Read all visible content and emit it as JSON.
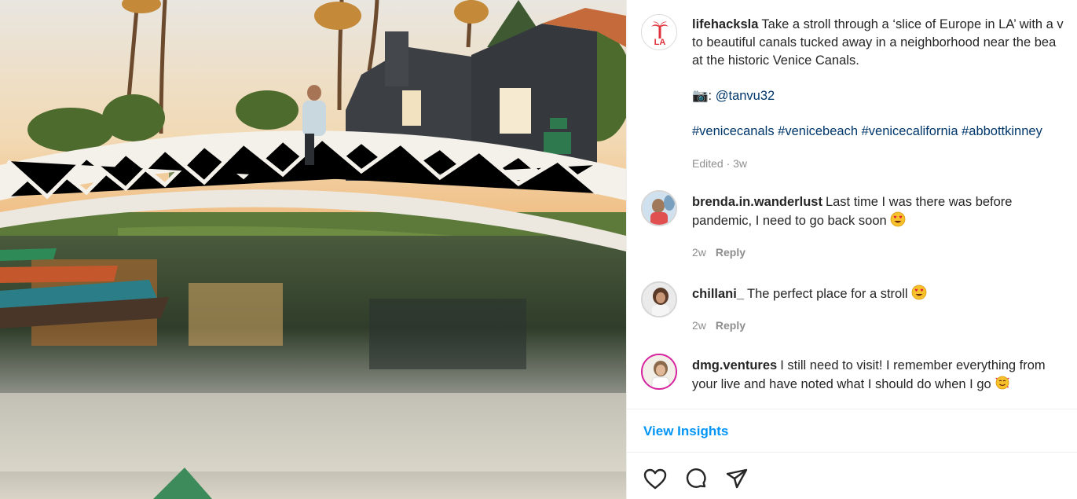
{
  "post": {
    "author": "lifehacksla",
    "caption_line1": "Take a stroll through a ‘slice of Europe in LA’ with a v",
    "caption_line2": "to beautiful canals tucked away in a neighborhood near the bea",
    "caption_line3": "at the historic Venice Canals.",
    "camera_emoji": "📷",
    "photo_credit_sep": ":",
    "photo_credit": "@tanvu32",
    "hashtags": [
      "#venicecanals",
      "#venicebeach",
      "#venicecalifornia",
      "#abbottkinney"
    ],
    "edited": "Edited · 3w"
  },
  "comments": [
    {
      "user": "brenda.in.wanderlust",
      "line1": "Last time I was there was before",
      "line2": "pandemic, I need to go back soon",
      "emoji": "heart-eyes",
      "age": "2w",
      "reply": "Reply"
    },
    {
      "user": "chillani_",
      "line1": "The perfect place for a stroll",
      "emoji": "heart-eyes",
      "age": "2w",
      "reply": "Reply"
    },
    {
      "user": "dmg.ventures",
      "line1": "I still need to visit! I remember everything from",
      "line2": "your live and have noted what I should do when I go",
      "emoji": "smiling-hearts"
    }
  ],
  "insights_label": "View Insights",
  "actions": {
    "like": "heart-icon",
    "comment": "comment-icon",
    "share": "share-icon"
  },
  "colors": {
    "link": "#00376b",
    "accent": "#0095f6",
    "muted": "#8e8e8e",
    "text": "#262626"
  }
}
